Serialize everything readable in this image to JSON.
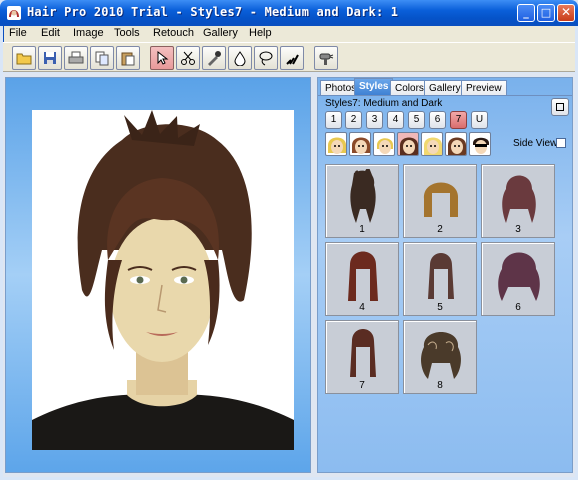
{
  "window": {
    "title": "Hair Pro 2010 Trial - Styles7 - Medium and Dark: 1"
  },
  "menu": [
    "File",
    "Edit",
    "Image",
    "Tools",
    "Retouch",
    "Gallery",
    "Help"
  ],
  "toolbar_icons": [
    "open-folder-icon",
    "save-disk-icon",
    "print-icon",
    "copy-icon",
    "paste-icon",
    "select-arrow-icon",
    "scissors-icon",
    "eyedropper-icon",
    "drop-icon",
    "lasso-icon",
    "brush-icon",
    "hair-dryer-icon"
  ],
  "tabs": [
    "Photos",
    "Styles",
    "Colors",
    "Gallery",
    "Preview"
  ],
  "active_tab": "Styles",
  "styles_label": "Styles7: Medium and Dark",
  "style_buttons": [
    "1",
    "2",
    "3",
    "4",
    "5",
    "6",
    "7",
    "U"
  ],
  "selected_style": "7",
  "face_buttons": [
    "face-type-1",
    "face-type-2",
    "face-type-3",
    "face-type-4",
    "face-type-5",
    "face-type-6",
    "face-type-7"
  ],
  "selected_face": 4,
  "side_view": {
    "label": "Side View",
    "checked": false
  },
  "gallery": [
    {
      "label": "1",
      "hair": "#3a2a22"
    },
    {
      "label": "2",
      "hair": "#a4742e"
    },
    {
      "label": "3",
      "hair": "#6a3a3e"
    },
    {
      "label": "4",
      "hair": "#6c2a1e"
    },
    {
      "label": "5",
      "hair": "#5a3a34"
    },
    {
      "label": "6",
      "hair": "#5e3448"
    },
    {
      "label": "7",
      "hair": "#5a2c22"
    },
    {
      "label": "8",
      "hair": "#4a3a2a"
    }
  ]
}
